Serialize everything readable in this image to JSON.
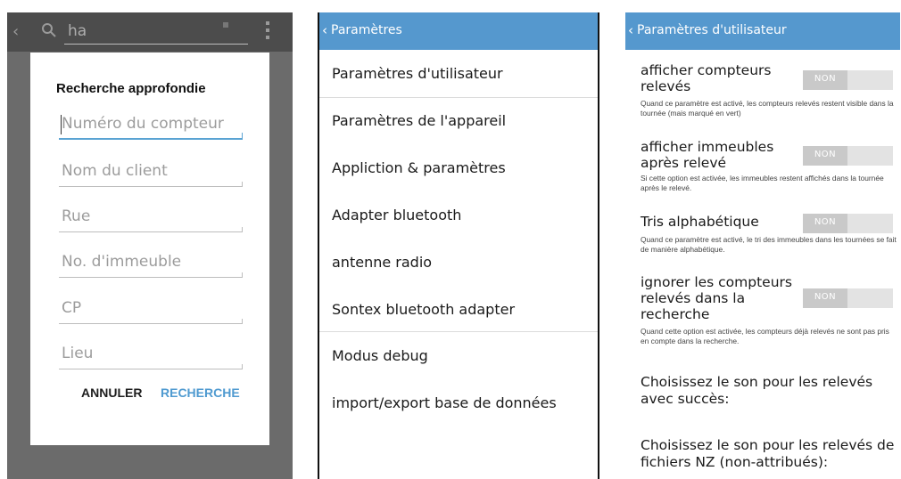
{
  "search_screen": {
    "query": "ha",
    "dialog": {
      "title": "Recherche approfondie",
      "fields": [
        {
          "placeholder": "Numéro du compteur"
        },
        {
          "placeholder": "Nom du client"
        },
        {
          "placeholder": "Rue"
        },
        {
          "placeholder": "No. d'immeuble"
        },
        {
          "placeholder": "CP"
        },
        {
          "placeholder": "Lieu"
        }
      ],
      "cancel_label": "ANNULER",
      "search_label": "RECHERCHE"
    }
  },
  "settings_screen": {
    "title": "Paramètres",
    "items": [
      {
        "label": "Paramètres d'utilisateur"
      },
      {
        "label": "Paramètres de l'appareil"
      },
      {
        "label": "Appliction & paramètres"
      },
      {
        "label": "Adapter bluetooth"
      },
      {
        "label": "antenne radio"
      },
      {
        "label": "Sontex bluetooth adapter"
      },
      {
        "label": "Modus debug"
      },
      {
        "label": "import/export base de données"
      }
    ]
  },
  "user_settings_screen": {
    "title": "Paramètres d'utilisateur",
    "toggles": [
      {
        "title": "afficher compteurs relevés",
        "state": "NON",
        "description": "Quand ce paramètre est activé, les compteurs relevés restent visible dans la tournée (mais marqué en vert)"
      },
      {
        "title": "afficher immeubles après relevé",
        "state": "NON",
        "description": "Si cette option est activée, les immeubles restent affichés dans la tournée après le relevé."
      },
      {
        "title": "Tris alphabétique",
        "state": "NON",
        "description": "Quand ce paramètre est activé, le tri des immeubles dans les tournées se fait de manière alphabétique."
      },
      {
        "title": "ignorer les compteurs relevés dans la recherche",
        "state": "NON",
        "description": "Quand cette option est activée, les compteurs déjà relevés ne sont pas pris en compte dans la recherche."
      }
    ],
    "sound_success": "Choisissez le son pour les relevés avec succès:",
    "sound_nz": "Choisissez le son pour les relevés de fichiers NZ (non-attribués):"
  }
}
